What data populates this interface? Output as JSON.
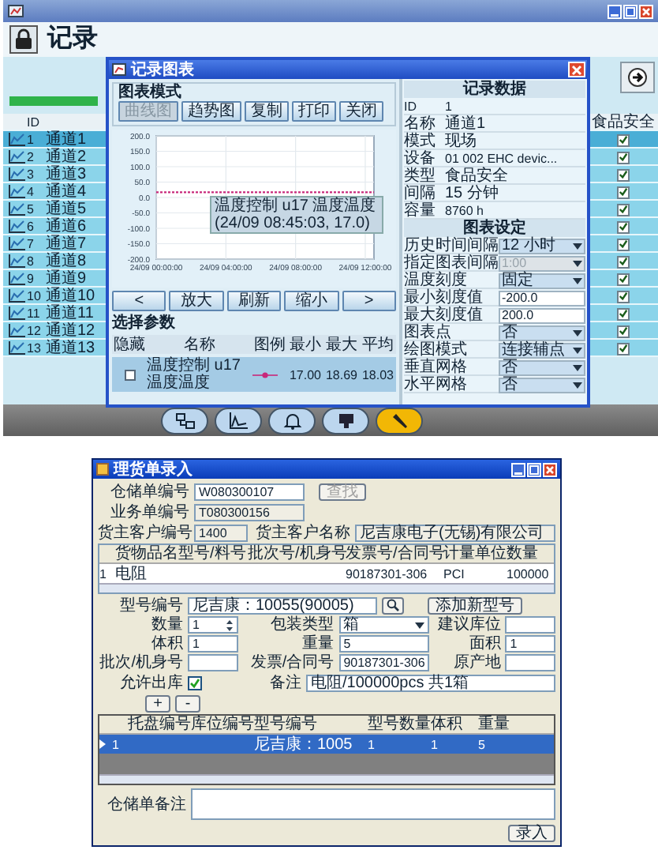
{
  "main_window": {
    "header": "记录",
    "channels": {
      "columns": [
        "ID",
        "食品安全"
      ],
      "rows": [
        {
          "id": "1",
          "name": "通道1",
          "selected": true,
          "checked": true
        },
        {
          "id": "2",
          "name": "通道2",
          "selected": false,
          "checked": true
        },
        {
          "id": "3",
          "name": "通道3",
          "selected": false,
          "checked": true
        },
        {
          "id": "4",
          "name": "通道4",
          "selected": false,
          "checked": true
        },
        {
          "id": "5",
          "name": "通道5",
          "selected": false,
          "checked": true
        },
        {
          "id": "6",
          "name": "通道6",
          "selected": false,
          "checked": true
        },
        {
          "id": "7",
          "name": "通道7",
          "selected": false,
          "checked": true
        },
        {
          "id": "8",
          "name": "通道8",
          "selected": false,
          "checked": true
        },
        {
          "id": "9",
          "name": "通道9",
          "selected": false,
          "checked": true
        },
        {
          "id": "10",
          "name": "通道10",
          "selected": false,
          "checked": true
        },
        {
          "id": "11",
          "name": "通道11",
          "selected": false,
          "checked": true
        },
        {
          "id": "12",
          "name": "通道12",
          "selected": false,
          "checked": true
        },
        {
          "id": "13",
          "name": "通道13",
          "selected": false,
          "checked": true
        }
      ]
    }
  },
  "dialog": {
    "title": "记录图表",
    "mode_group": "图表模式",
    "mode_buttons": [
      {
        "label": "曲线图",
        "disabled": true
      },
      {
        "label": "趋势图",
        "disabled": false
      },
      {
        "label": "复制",
        "disabled": false
      },
      {
        "label": "打印",
        "disabled": false
      },
      {
        "label": "关闭",
        "disabled": false
      }
    ],
    "chart_data": {
      "type": "line",
      "categories": [
        "24/09 00:00:00",
        null,
        null,
        null,
        null,
        null,
        null,
        null,
        "24/09 04:00:00",
        null,
        null,
        null,
        null,
        null,
        null,
        null,
        "24/09 08:00:00",
        null,
        null,
        null,
        null,
        null,
        null,
        null,
        "24/09 12:00:00",
        null
      ],
      "series": [
        {
          "name": "温度控制 u17 温度温度",
          "color": "#c8287a",
          "line_style": "dashed",
          "values": [
            17,
            17,
            17,
            17,
            17,
            17,
            17,
            17,
            17,
            17,
            17,
            17,
            17,
            17,
            17,
            17,
            17,
            17,
            17,
            17,
            17,
            17,
            17,
            17,
            17,
            17
          ]
        }
      ],
      "ylim": [
        -200,
        200
      ],
      "grid": true,
      "yticks": [
        {
          "value": 200,
          "label": "200.0"
        },
        {
          "value": 150,
          "label": "150.0"
        },
        {
          "value": 100,
          "label": "100.0"
        },
        {
          "value": 50,
          "label": "50.0"
        },
        {
          "value": 0,
          "label": "0.0"
        },
        {
          "value": -50,
          "label": "-50.0"
        },
        {
          "value": -100,
          "label": "-100.0"
        },
        {
          "value": -150,
          "label": "-150.0"
        },
        {
          "value": -200,
          "label": "-200.0"
        }
      ]
    },
    "tooltip": "温度控制 u17 温度温度 (24/09 08:45:03, 17.0)",
    "nav_buttons": [
      "<",
      "放大",
      "刷新",
      "缩小",
      ">"
    ],
    "params": {
      "title": "选择参数",
      "columns": [
        "隐藏",
        "名称",
        "图例",
        "最小",
        "最大",
        "平均"
      ],
      "rows": [
        {
          "min": "17.00",
          "max": "18.69",
          "avg": "18.03",
          "selected": true
        }
      ]
    },
    "record_data": {
      "title": "记录数据",
      "rows": [
        {
          "label": "ID",
          "value": "1"
        },
        {
          "label": "名称",
          "value": "通道1"
        },
        {
          "label": "模式",
          "value": "现场"
        },
        {
          "label": "设备",
          "value": "01 002 EHC devic..."
        },
        {
          "label": "类型",
          "value": "食品安全"
        },
        {
          "label": "间隔",
          "value": "15 分钟"
        },
        {
          "label": "容量",
          "value": "8760 h"
        }
      ]
    },
    "chart_settings": {
      "title": "图表设定",
      "rows": [
        {
          "label": "历史时间间隔",
          "value": "12 小时",
          "kind": "select",
          "disabled": false
        },
        {
          "label": "指定图表间隔",
          "value": "1:00",
          "kind": "select",
          "disabled": true
        },
        {
          "label": "温度刻度",
          "value": "固定",
          "kind": "select",
          "disabled": false
        },
        {
          "label": "最小刻度值",
          "value": "-200.0",
          "kind": "input",
          "disabled": false
        },
        {
          "label": "最大刻度值",
          "value": "200.0",
          "kind": "input",
          "disabled": false
        },
        {
          "label": "图表点",
          "value": "否",
          "kind": "select",
          "disabled": false
        },
        {
          "label": "绘图模式",
          "value": "连接辅点",
          "kind": "select",
          "disabled": false
        },
        {
          "label": "垂直网格",
          "value": "否",
          "kind": "select",
          "disabled": false
        },
        {
          "label": "水平网格",
          "value": "否",
          "kind": "select",
          "disabled": false
        }
      ]
    }
  },
  "entry_window": {
    "title": "理货单录入",
    "warehouse_no": {
      "label": "仓储单编号",
      "value": "W080300107"
    },
    "find_button": {
      "label": "查找",
      "disabled": true
    },
    "business_no": {
      "label": "业务单编号",
      "value": "T080300156"
    },
    "owner_code": {
      "label": "货主客户编号",
      "value": "1400"
    },
    "owner_name": {
      "label": "货主客户名称",
      "value": "尼吉康电子(无锡)有限公司"
    },
    "goods_table": {
      "columns": [
        "货物品名",
        "型号/料号",
        "批次号/机身号",
        "发票号/合同号",
        "计量单位",
        "数量"
      ],
      "rows": [
        {
          "row": "1",
          "goods": "电阻",
          "invoice": "90187301-306",
          "unit": "PCI",
          "qty": "100000"
        }
      ]
    },
    "model_no": {
      "label": "型号编号",
      "value": "尼吉康：10055(90005)"
    },
    "add_model_button": "添加新型号",
    "fields": [
      {
        "label": "数量",
        "value": "1",
        "kind": "spin"
      },
      {
        "label": "包装类型",
        "value": "箱",
        "kind": "select"
      },
      {
        "label": "建议库位",
        "kind": "text"
      },
      {
        "label": "体积",
        "value": "1",
        "kind": "text"
      },
      {
        "label": "重量",
        "value": "5",
        "kind": "text"
      },
      {
        "label": "面积",
        "value": "1",
        "kind": "text"
      },
      {
        "label": "批次/机身号",
        "kind": "text"
      },
      {
        "label": "发票/合同号",
        "value": "90187301-306",
        "kind": "text"
      },
      {
        "label": "原产地",
        "kind": "text"
      }
    ],
    "allow_out": {
      "label": "允许出库",
      "checked": true
    },
    "remark": {
      "label": "备注",
      "value": "电阻/100000pcs 共1箱"
    },
    "row_buttons": [
      "+",
      "-"
    ],
    "pallet_table": {
      "columns": [
        "托盘编号",
        "库位编号",
        "型号编号",
        "型号数量",
        "体积",
        "重量"
      ],
      "rows": [
        {
          "row": "1",
          "selected": true,
          "model": "尼吉康：1005",
          "qty": "1",
          "volume": "1",
          "weight": "5"
        }
      ]
    },
    "note": {
      "label": "仓储单备注"
    },
    "submit_button": "录入"
  }
}
